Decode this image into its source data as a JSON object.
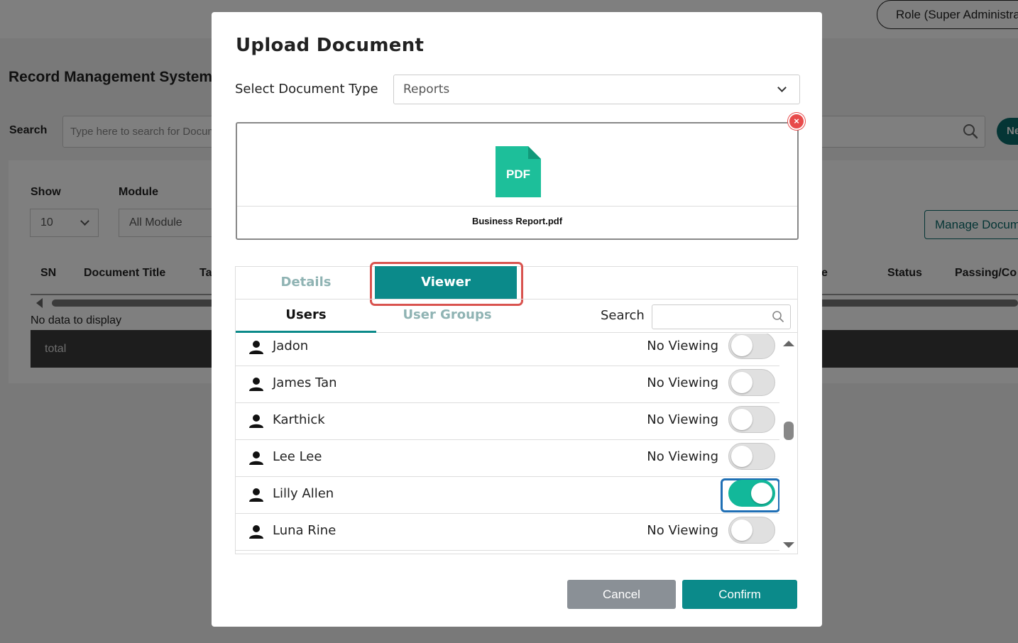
{
  "background": {
    "role_label": "Role (Super Administrator)",
    "page_title": "Record Management System",
    "search_label": "Search",
    "search_placeholder": "Type here to search for Documents",
    "new_button": "New",
    "show_label": "Show",
    "show_value": "10",
    "module_label": "Module",
    "module_value": "All Module",
    "manage_button": "Manage Documents",
    "columns": [
      "SN",
      "Document Title",
      "Ta",
      "e",
      "Status",
      "Passing/Co"
    ],
    "no_data": "No data to display",
    "total_label": "total"
  },
  "modal": {
    "title": "Upload Document",
    "doctype_label": "Select Document Type",
    "doctype_value": "Reports",
    "file": {
      "icon_text": "PDF",
      "name": "Business Report.pdf",
      "remove_glyph": "×"
    },
    "tabs": {
      "details": "Details",
      "viewer": "Viewer"
    },
    "subtabs": {
      "users": "Users",
      "user_groups": "User Groups",
      "search_label": "Search",
      "search_value": ""
    },
    "users": [
      {
        "name": "Jadon",
        "status": "No Viewing",
        "enabled": false
      },
      {
        "name": "James Tan",
        "status": "No Viewing",
        "enabled": false
      },
      {
        "name": "Karthick",
        "status": "No Viewing",
        "enabled": false
      },
      {
        "name": "Lee Lee",
        "status": "No Viewing",
        "enabled": false
      },
      {
        "name": "Lilly Allen",
        "status": "",
        "enabled": true
      },
      {
        "name": "Luna Rine",
        "status": "No Viewing",
        "enabled": false
      }
    ],
    "cancel_label": "Cancel",
    "confirm_label": "Confirm"
  },
  "colors": {
    "accent": "#0b8a8a",
    "toggle_on": "#12b89a",
    "pdf_icon": "#1dbf9a",
    "highlight_red": "#d9534f",
    "highlight_blue": "#1f6fb5"
  },
  "icons": {
    "user": "user-icon",
    "search": "search-icon",
    "chevron": "chevron-down-icon",
    "pdf": "pdf-file-icon",
    "remove": "close-icon"
  }
}
